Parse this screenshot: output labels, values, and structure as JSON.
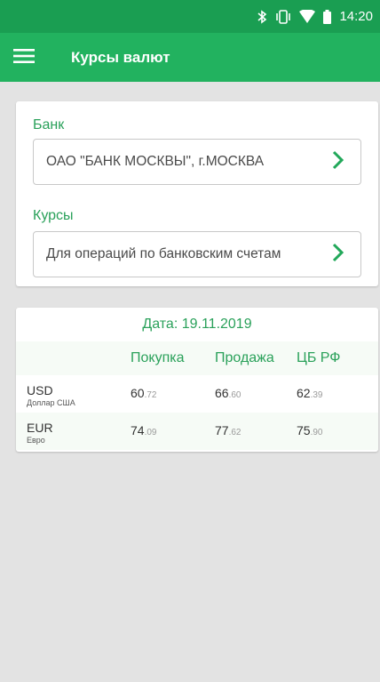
{
  "status_bar": {
    "time": "14:20"
  },
  "app_bar": {
    "title": "Курсы валют",
    "menu_icon": "hamburger-menu-icon"
  },
  "bank_card": {
    "bank_label": "Банк",
    "bank_value": "ОАО \"БАНК МОСКВЫ\", г.МОСКВА",
    "rates_label": "Курсы",
    "rates_value": "Для операций по банковским счетам"
  },
  "rates_card": {
    "date": "Дата: 19.11.2019",
    "columns": [
      "Покупка",
      "Продажа",
      "ЦБ РФ"
    ],
    "rows": [
      {
        "code": "USD",
        "name": "Доллар США",
        "buy_int": "60",
        "buy_frac": ".72",
        "sell_int": "66",
        "sell_frac": ".60",
        "cb_int": "62",
        "cb_frac": ".39"
      },
      {
        "code": "EUR",
        "name": "Евро",
        "buy_int": "74",
        "buy_frac": ".09",
        "sell_int": "77",
        "sell_frac": ".62",
        "cb_int": "75",
        "cb_frac": ".90"
      }
    ]
  },
  "colors": {
    "status_bar": "#1a9e52",
    "app_bar": "#22b25f",
    "accent": "#2aa15a",
    "background": "#e3e3e3"
  }
}
